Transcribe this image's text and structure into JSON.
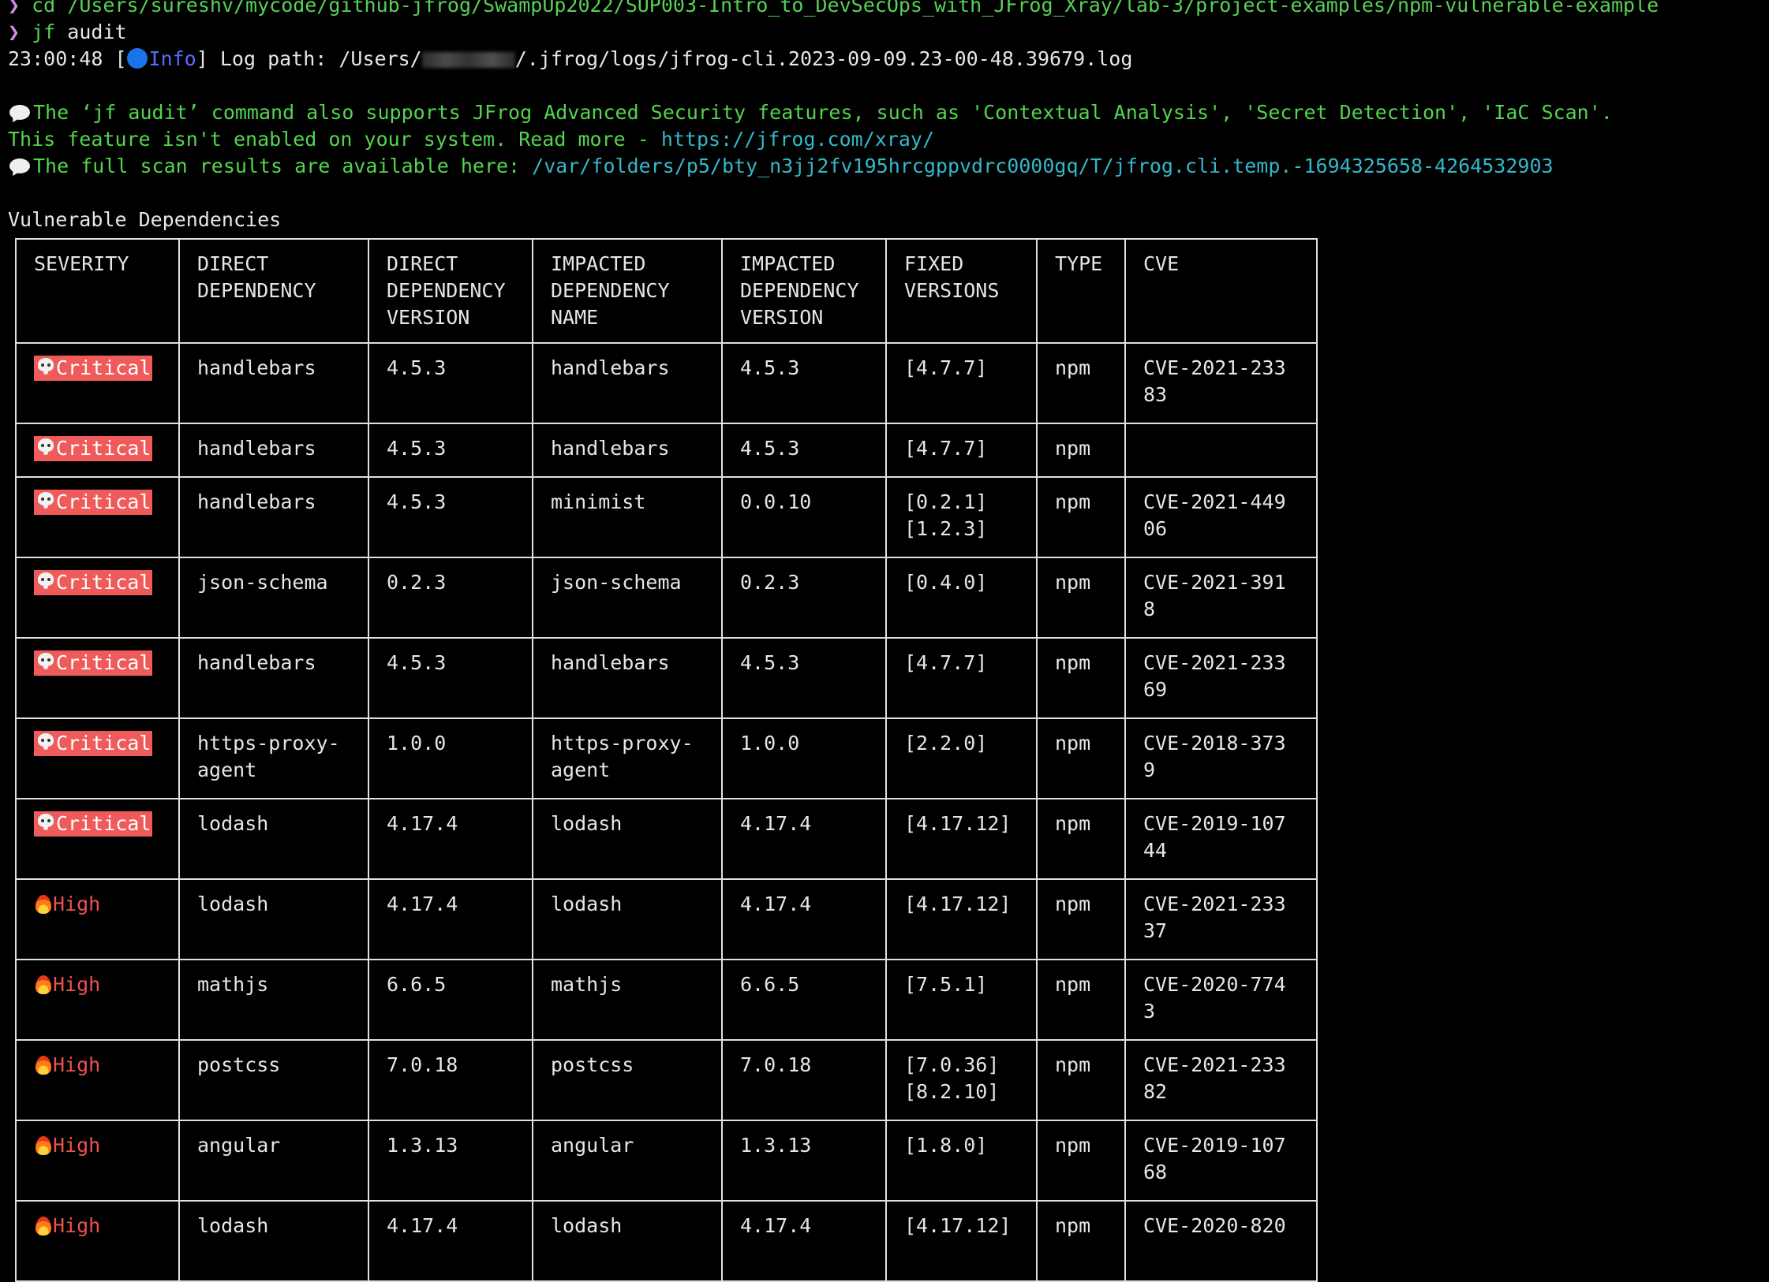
{
  "terminal": {
    "prev_command_line": "cd /Users/sureshv/mycode/github-jfrog/SwampUp2022/SUP003-Intro_to_DevSecOps_with_JFrog_Xray/lab-3/project-examples/npm-vulnerable-example",
    "prompt_symbol": "❯",
    "command_name": "jf",
    "command_args": "audit",
    "log": {
      "time": "23:00:48",
      "level": "Info",
      "text_before": "Log path: /Users/",
      "text_after": "/.jfrog/logs/jfrog-cli.2023-09-09.23-00-48.39679.log"
    },
    "notice1": {
      "line1": "The ‘jf audit’ command also supports JFrog Advanced Security features, such as 'Contextual Analysis', 'Secret Detection', 'IaC Scan'.",
      "line2_text": "This feature isn't enabled on your system. Read more - ",
      "link": "https://jfrog.com/xray/"
    },
    "notice2": {
      "text": "The full scan results are available here: ",
      "path": "/var/folders/p5/bty_n3jj2fv195hrcgppvdrc0000gq/T/jfrog.cli.temp.-1694325658-4264532903"
    },
    "section_title": "Vulnerable Dependencies"
  },
  "table": {
    "headers": [
      "SEVERITY",
      "DIRECT\nDEPENDENCY",
      "DIRECT\nDEPENDENCY\nVERSION",
      "IMPACTED\nDEPENDENCY\nNAME",
      "IMPACTED\nDEPENDENCY\nVERSION",
      "FIXED\nVERSIONS",
      "TYPE",
      "CVE"
    ],
    "rows": [
      {
        "severity": "Critical",
        "direct": "handlebars",
        "direct_version": "4.5.3",
        "impacted": "handlebars",
        "impacted_version": "4.5.3",
        "fixed": "[4.7.7]",
        "type": "npm",
        "cve": "CVE-2021-233\n83"
      },
      {
        "severity": "Critical",
        "direct": "handlebars",
        "direct_version": "4.5.3",
        "impacted": "handlebars",
        "impacted_version": "4.5.3",
        "fixed": "[4.7.7]",
        "type": "npm",
        "cve": ""
      },
      {
        "severity": "Critical",
        "direct": "handlebars",
        "direct_version": "4.5.3",
        "impacted": "minimist",
        "impacted_version": "0.0.10",
        "fixed": "[0.2.1]\n[1.2.3]",
        "type": "npm",
        "cve": "CVE-2021-449\n06"
      },
      {
        "severity": "Critical",
        "direct": "json-schema",
        "direct_version": "0.2.3",
        "impacted": "json-schema",
        "impacted_version": "0.2.3",
        "fixed": "[0.4.0]",
        "type": "npm",
        "cve": "CVE-2021-391\n8"
      },
      {
        "severity": "Critical",
        "direct": "handlebars",
        "direct_version": "4.5.3",
        "impacted": "handlebars",
        "impacted_version": "4.5.3",
        "fixed": "[4.7.7]",
        "type": "npm",
        "cve": "CVE-2021-233\n69"
      },
      {
        "severity": "Critical",
        "direct": "https-proxy-\nagent",
        "direct_version": "1.0.0",
        "impacted": "https-proxy-\nagent",
        "impacted_version": "1.0.0",
        "fixed": "[2.2.0]",
        "type": "npm",
        "cve": "CVE-2018-373\n9"
      },
      {
        "severity": "Critical",
        "direct": "lodash",
        "direct_version": "4.17.4",
        "impacted": "lodash",
        "impacted_version": "4.17.4",
        "fixed": "[4.17.12]",
        "type": "npm",
        "cve": "CVE-2019-107\n44"
      },
      {
        "severity": "High",
        "direct": "lodash",
        "direct_version": "4.17.4",
        "impacted": "lodash",
        "impacted_version": "4.17.4",
        "fixed": "[4.17.12]",
        "type": "npm",
        "cve": "CVE-2021-233\n37"
      },
      {
        "severity": "High",
        "direct": "mathjs",
        "direct_version": "6.6.5",
        "impacted": "mathjs",
        "impacted_version": "6.6.5",
        "fixed": "[7.5.1]",
        "type": "npm",
        "cve": "CVE-2020-774\n3"
      },
      {
        "severity": "High",
        "direct": "postcss",
        "direct_version": "7.0.18",
        "impacted": "postcss",
        "impacted_version": "7.0.18",
        "fixed": "[7.0.36]\n[8.2.10]",
        "type": "npm",
        "cve": "CVE-2021-233\n82"
      },
      {
        "severity": "High",
        "direct": "angular",
        "direct_version": "1.3.13",
        "impacted": "angular",
        "impacted_version": "1.3.13",
        "fixed": "[1.8.0]",
        "type": "npm",
        "cve": "CVE-2019-107\n68"
      },
      {
        "severity": "High",
        "direct": "lodash",
        "direct_version": "4.17.4",
        "impacted": "lodash",
        "impacted_version": "4.17.4",
        "fixed": "[4.17.12]",
        "type": "npm",
        "cve": "CVE-2020-820"
      }
    ]
  },
  "icons": {
    "critical": "skull-icon",
    "high": "fire-icon",
    "info": "blue-circle-icon",
    "notice": "speech-bubble-icon"
  },
  "colors": {
    "background": "#000000",
    "critical_bg": "#ef5b5b",
    "high_text": "#ef5050",
    "notice_green": "#53d54d",
    "link_cyan": "#34b8c9",
    "info_blue": "#5a6cff"
  }
}
